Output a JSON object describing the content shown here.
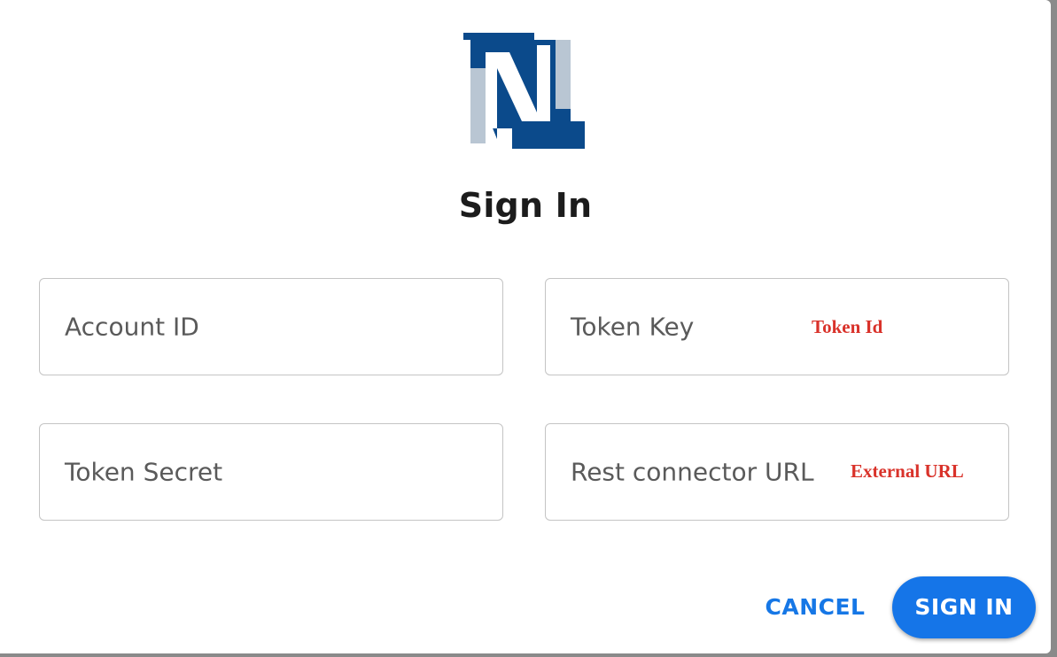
{
  "dialog": {
    "title": "Sign In",
    "logo_icon": "netsuite-logo-icon"
  },
  "fields": {
    "account_id": {
      "placeholder": "Account ID",
      "value": ""
    },
    "token_key": {
      "placeholder": "Token Key",
      "value": ""
    },
    "token_secret": {
      "placeholder": "Token Secret",
      "value": ""
    },
    "rest_connector_url": {
      "placeholder": "Rest connector URL",
      "value": ""
    }
  },
  "annotations": {
    "token_key_note": "Token Id",
    "url_note": "External URL"
  },
  "actions": {
    "cancel_label": "CANCEL",
    "signin_label": "SIGN IN"
  },
  "colors": {
    "brand_dark_blue": "#0b4a8b",
    "brand_light_blue": "#b9c6d3",
    "primary_button": "#1575e8",
    "annotation_red": "#d9322a"
  }
}
